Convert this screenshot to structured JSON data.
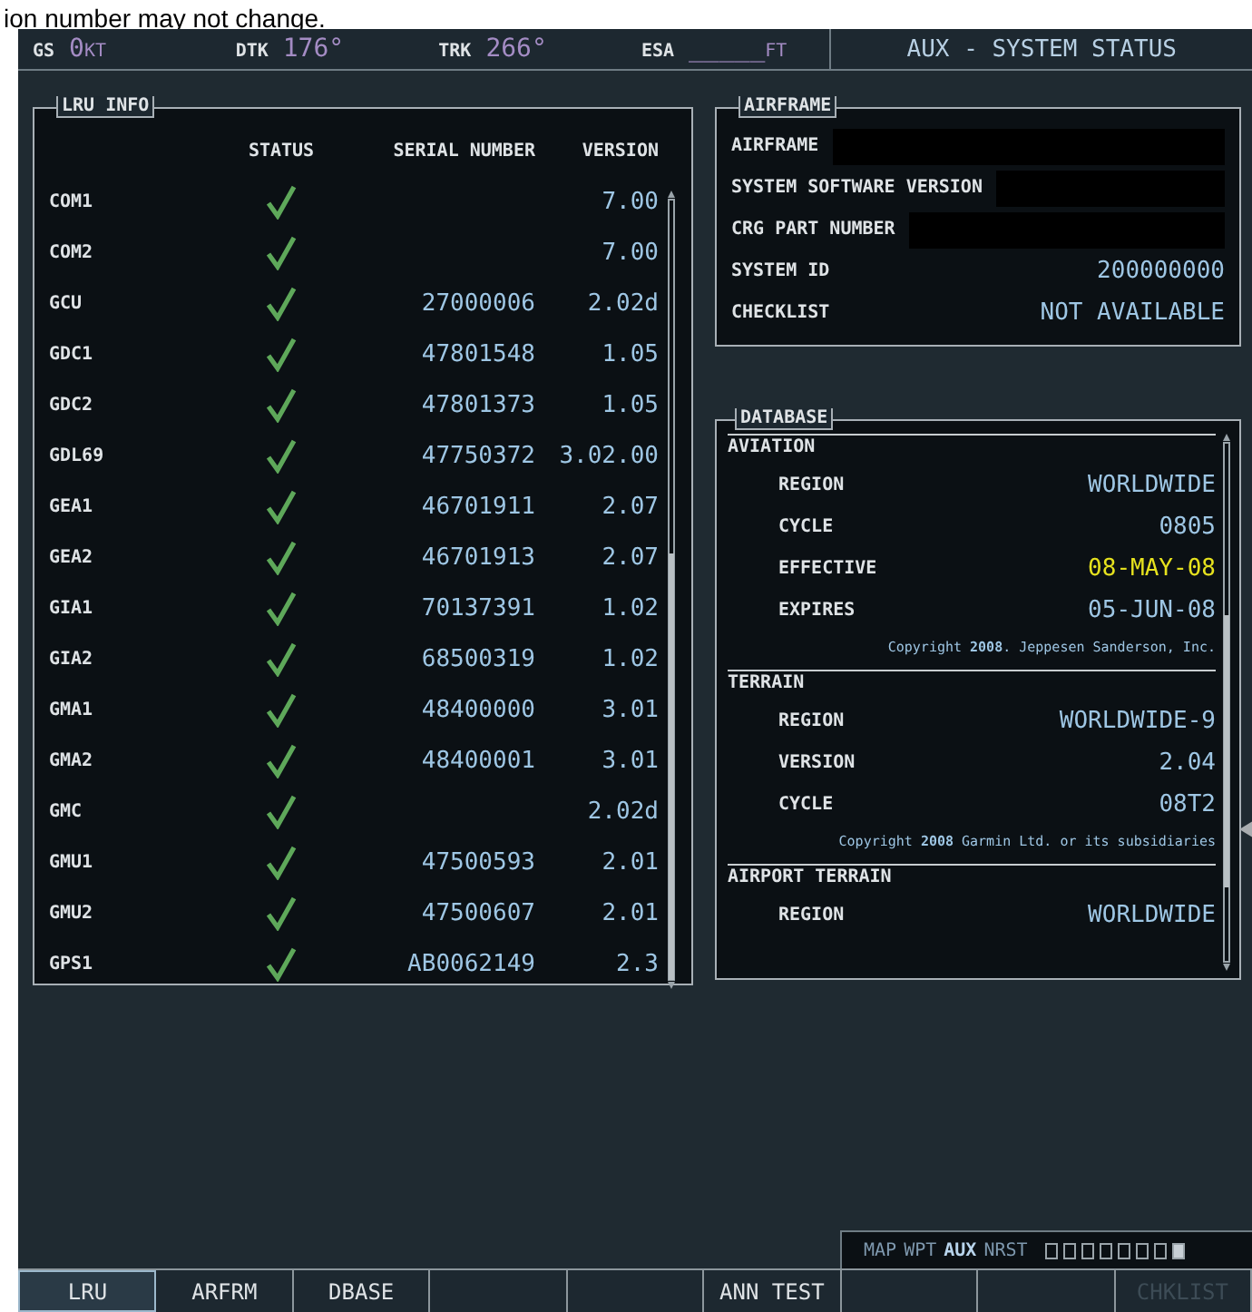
{
  "caption": "ion number may not change.",
  "top_bar": {
    "fields": [
      {
        "label": "GS",
        "value": "0",
        "unit": "KT"
      },
      {
        "label": "DTK",
        "value": "176°"
      },
      {
        "label": "TRK",
        "value": "266°"
      },
      {
        "label": "ESA",
        "value": "_____",
        "unit": "FT"
      }
    ],
    "page_title": "AUX - SYSTEM STATUS"
  },
  "lru_info": {
    "title": "LRU INFO",
    "columns": [
      "STATUS",
      "SERIAL NUMBER",
      "VERSION"
    ],
    "rows": [
      {
        "name": "COM1",
        "ok": true,
        "version": "7.00"
      },
      {
        "name": "COM2",
        "ok": true,
        "version": "7.00"
      },
      {
        "name": "GCU",
        "ok": true,
        "serial": "27000006",
        "version": "2.02d"
      },
      {
        "name": "GDC1",
        "ok": true,
        "serial": "47801548",
        "version": "1.05"
      },
      {
        "name": "GDC2",
        "ok": true,
        "serial": "47801373",
        "version": "1.05"
      },
      {
        "name": "GDL69",
        "ok": true,
        "serial": "47750372",
        "version": "3.02.00"
      },
      {
        "name": "GEA1",
        "ok": true,
        "serial": "46701911",
        "version": "2.07"
      },
      {
        "name": "GEA2",
        "ok": true,
        "serial": "46701913",
        "version": "2.07"
      },
      {
        "name": "GIA1",
        "ok": true,
        "serial": "70137391",
        "version": "1.02"
      },
      {
        "name": "GIA2",
        "ok": true,
        "serial": "68500319",
        "version": "1.02"
      },
      {
        "name": "GMA1",
        "ok": true,
        "serial": "48400000",
        "version": "3.01"
      },
      {
        "name": "GMA2",
        "ok": true,
        "serial": "48400001",
        "version": "3.01"
      },
      {
        "name": "GMC",
        "ok": true,
        "version": "2.02d"
      },
      {
        "name": "GMU1",
        "ok": true,
        "serial": "47500593",
        "version": "2.01"
      },
      {
        "name": "GMU2",
        "ok": true,
        "serial": "47500607",
        "version": "2.01"
      },
      {
        "name": "GPS1",
        "ok": true,
        "serial": "AB0062149",
        "version": "2.3"
      }
    ]
  },
  "airframe": {
    "title": "AIRFRAME",
    "rows": [
      {
        "label": "AIRFRAME",
        "redacted": true
      },
      {
        "label": "SYSTEM SOFTWARE VERSION",
        "redacted": true
      },
      {
        "label": "CRG PART NUMBER",
        "redacted": true
      },
      {
        "label": "SYSTEM ID",
        "value": "200000000"
      },
      {
        "label": "CHECKLIST",
        "value": "NOT AVAILABLE"
      }
    ]
  },
  "database": {
    "title": "DATABASE",
    "sections": [
      {
        "heading": "AVIATION",
        "rows": [
          {
            "label": "REGION",
            "value": "WORLDWIDE",
            "highlighted": false
          },
          {
            "label": "CYCLE",
            "value": "0805",
            "highlighted": false
          },
          {
            "label": "EFFECTIVE",
            "value": "08-MAY-08",
            "highlighted": true
          },
          {
            "label": "EXPIRES",
            "value": "05-JUN-08",
            "highlighted": false
          }
        ],
        "copyright": "Copyright **2008**. Jeppesen Sanderson, Inc."
      },
      {
        "heading": "TERRAIN",
        "rows": [
          {
            "label": "REGION",
            "value": "WORLDWIDE-9",
            "highlighted": false
          },
          {
            "label": "VERSION",
            "value": "2.04",
            "highlighted": false
          },
          {
            "label": "CYCLE",
            "value": "08T2",
            "highlighted": false
          }
        ],
        "copyright": "Copyright **2008** Garmin Ltd. or its subsidiaries"
      },
      {
        "heading": "AIRPORT TERRAIN",
        "rows": [
          {
            "label": "REGION",
            "value": "WORLDWIDE",
            "highlighted": false
          }
        ]
      }
    ]
  },
  "page_nav": {
    "groups": [
      {
        "label": "MAP",
        "selected": false
      },
      {
        "label": "WPT",
        "selected": false
      },
      {
        "label": "AUX",
        "selected": true
      },
      {
        "label": "NRST",
        "selected": false
      }
    ],
    "pages": [
      {
        "selected": false
      },
      {
        "selected": false
      },
      {
        "selected": false
      },
      {
        "selected": false
      },
      {
        "selected": false
      },
      {
        "selected": false
      },
      {
        "selected": false
      },
      {
        "selected": true
      }
    ]
  },
  "softkeys": [
    {
      "label": "LRU",
      "selected": true,
      "disabled": false
    },
    {
      "label": "ARFRM",
      "selected": false,
      "disabled": false
    },
    {
      "label": "DBASE",
      "selected": false,
      "disabled": false
    },
    {
      "selected": false
    },
    {
      "selected": false
    },
    {
      "label": "ANN TEST",
      "selected": false,
      "disabled": false
    },
    {
      "selected": false
    },
    {
      "selected": false
    },
    {
      "label": "CHKLIST",
      "selected": false,
      "disabled": true
    }
  ]
}
